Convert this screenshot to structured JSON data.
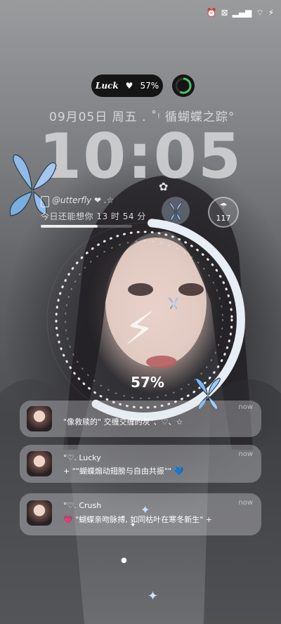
{
  "status": {
    "icons": [
      "alarm-off-icon",
      "sim-off-icon",
      "signal-icon",
      "wifi-icon",
      "bolt-icon"
    ]
  },
  "luck_pill": {
    "label": "Luck",
    "heart": "♥",
    "battery": "57%"
  },
  "date_line": "09月05日 周五  . ˚ᵎ 循蝴蝶之踪°",
  "clock": "10:05",
  "widget": {
    "name": "@utterfly ❤ .☆",
    "countdown": "今日还能想你 13 时 54 分",
    "progress": 0.62
  },
  "counter": {
    "value": "117",
    "glyph": "☂"
  },
  "battery_ring": {
    "percent": "57%",
    "level": 0.57
  },
  "notifications": [
    {
      "title": "",
      "body": "\"像救赎的\" 交缠交缠的灰\"、♡、☆",
      "time": "now"
    },
    {
      "title": "°♡. Lucky",
      "body": "+ \"\"蝴蝶煽动翅膀与自由共振\"\" 💙",
      "time": "now"
    },
    {
      "title": "°♡. Crush",
      "body": "💗 \"蝴蝶亲吻脉搏, 如同枯叶在寒冬新生\" +",
      "time": "now"
    }
  ],
  "colors": {
    "ring": "#dfe9f5",
    "butterfly": "#7fb6ee",
    "pill": "#151515"
  }
}
